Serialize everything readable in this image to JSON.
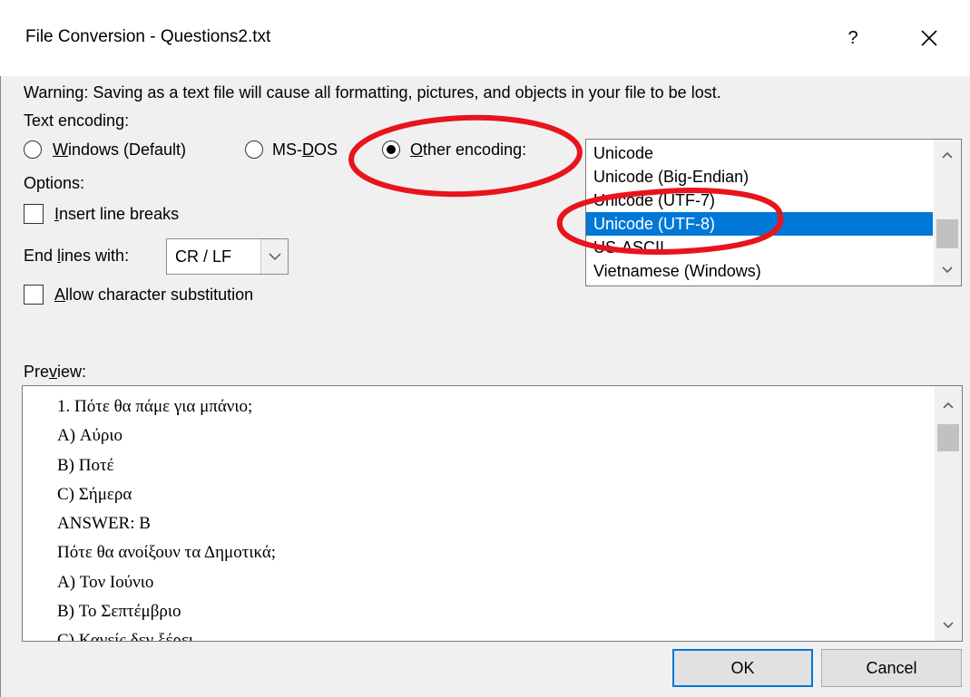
{
  "window": {
    "title": "File Conversion - Questions2.txt",
    "help_label": "?",
    "close_icon": "close-icon"
  },
  "warning": "Warning: Saving as a text file will cause all formatting, pictures, and objects in your file to be lost.",
  "text_encoding": {
    "label": "Text encoding:",
    "options": [
      {
        "accel": "W",
        "rest": "indows (Default)",
        "selected": false
      },
      {
        "pre": "MS-",
        "accel": "D",
        "rest": "OS",
        "selected": false
      },
      {
        "accel": "O",
        "rest": "ther encoding:",
        "selected": true
      }
    ]
  },
  "options": {
    "label": "Options:",
    "insert_line_breaks": {
      "accel": "I",
      "rest": "nsert line breaks",
      "checked": false
    },
    "end_lines": {
      "pre": "End ",
      "accel": "l",
      "rest": "ines with:",
      "value": "CR / LF"
    },
    "allow_substitution": {
      "accel": "A",
      "rest": "llow character substitution",
      "checked": false
    }
  },
  "encodings": {
    "items": [
      "Unicode",
      "Unicode (Big-Endian)",
      "Unicode (UTF-7)",
      "Unicode (UTF-8)",
      "US-ASCII",
      "Vietnamese (Windows)"
    ],
    "selected_index": 3
  },
  "preview": {
    "pre": "Pre",
    "accel": "v",
    "rest": "iew:",
    "lines": [
      "1. Πότε θα πάμε για μπάνιο;",
      "A) Αύριο",
      "B) Ποτέ",
      "C) Σήμερα",
      "ANSWER: B",
      "Πότε θα ανοίξουν τα Δημοτικά;",
      "A) Τον Ιούνιο",
      "B) Το Σεπτέμβριο",
      "C) Κανείς δεν ξέρει"
    ]
  },
  "buttons": {
    "ok": "OK",
    "cancel": "Cancel"
  },
  "colors": {
    "selection": "#0078d7",
    "annotation": "#e8141c",
    "dialog_bg": "#f0f0f0"
  }
}
